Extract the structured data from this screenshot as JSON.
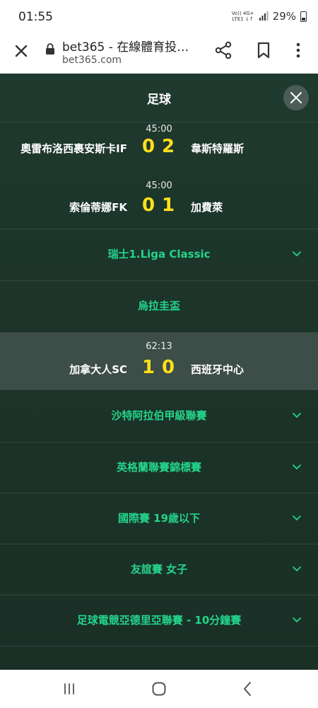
{
  "status": {
    "time": "01:55",
    "network_top": "Vo)) 4G+",
    "network_bottom": "LTE1 ↓↑",
    "battery": "29%"
  },
  "browser": {
    "title": "bet365 - 在線體育投…",
    "url": "bet365.com"
  },
  "panel": {
    "title": "足球"
  },
  "matches": [
    {
      "time": "45:00",
      "home": "奧雷布洛西裹安斯卡IF",
      "home_score": "0",
      "away_score": "2",
      "away": "韋斯特羅斯"
    },
    {
      "time": "45:00",
      "home": "索倫蒂娜FK",
      "home_score": "0",
      "away_score": "1",
      "away": "加費萊"
    },
    {
      "time": "62:13",
      "home": "加拿大人SC",
      "home_score": "1",
      "away_score": "0",
      "away": "西班牙中心"
    }
  ],
  "leagues": [
    {
      "label": "瑞士1.Liga Classic"
    },
    {
      "label": "烏拉圭盃"
    },
    {
      "label": "沙特阿拉伯甲級聯賽"
    },
    {
      "label": "英格蘭聯賽錦標賽"
    },
    {
      "label": "國際賽 19歲以下"
    },
    {
      "label": "友誼賽 女子"
    },
    {
      "label": "足球電競亞德里亞聯賽 - 10分鐘賽"
    }
  ],
  "colors": {
    "accent_green": "#24d48b",
    "score_yellow": "#ffdf1b",
    "panel_bg": "#1c342a"
  },
  "icons": [
    "close-icon",
    "lock-icon",
    "share-icon",
    "bookmark-icon",
    "more-icon",
    "chevron-down-icon",
    "recent-apps-icon",
    "home-icon",
    "back-icon"
  ]
}
